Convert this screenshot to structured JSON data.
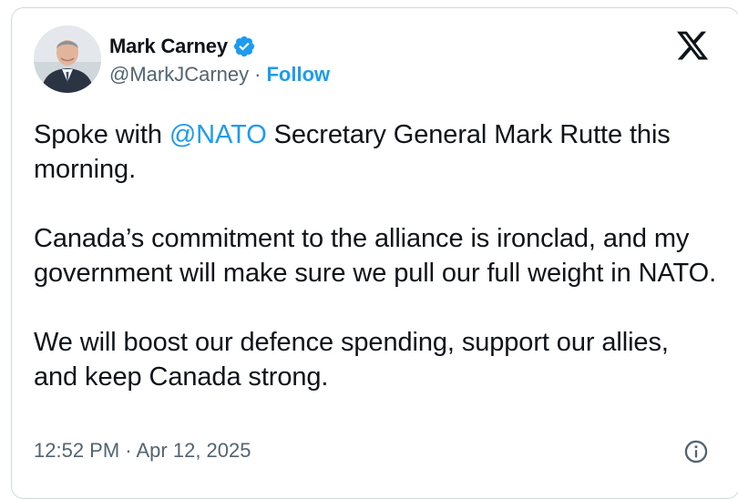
{
  "author": {
    "display_name": "Mark Carney",
    "handle": "@MarkJCarney",
    "separator": "·",
    "follow_label": "Follow",
    "verified": true
  },
  "icons": {
    "verified": "verified-badge-icon",
    "platform": "x-logo-icon",
    "info": "info-icon"
  },
  "colors": {
    "accent": "#1d9bf0",
    "text_primary": "#0f1419",
    "text_secondary": "#536471",
    "border": "#cfd9de"
  },
  "tweet": {
    "p1_before": "Spoke with ",
    "p1_mention": "@NATO",
    "p1_after": " Secretary General Mark Rutte this morning.",
    "p2": "Canada’s commitment to the alliance is ironclad, and my government will make sure we pull our full weight in NATO.",
    "p3": "We will boost our defence spending, support our allies, and keep Canada strong."
  },
  "meta": {
    "timestamp": "12:52 PM · Apr 12, 2025"
  }
}
